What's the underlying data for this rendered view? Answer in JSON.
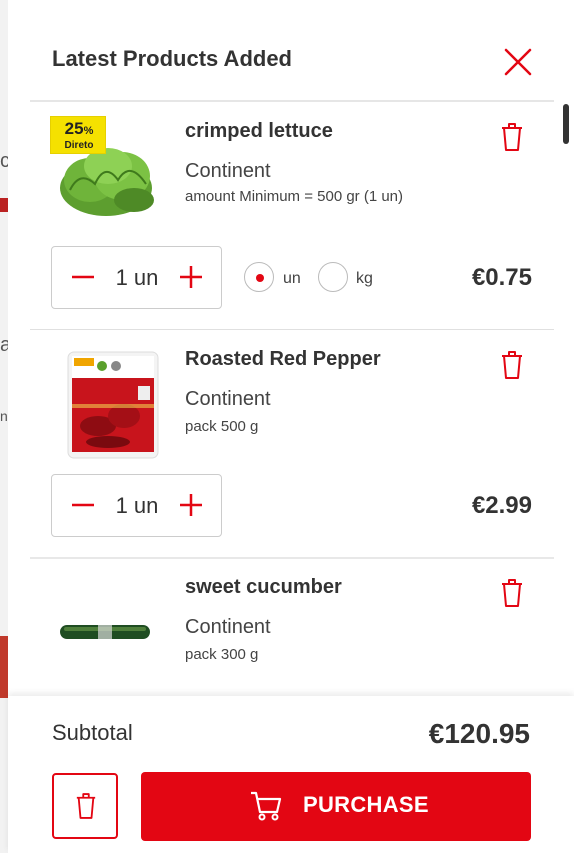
{
  "background_page": {
    "chars": [
      "c",
      "a",
      "n"
    ]
  },
  "cart": {
    "title": "Latest Products Added",
    "items": [
      {
        "name": "crimped lettuce",
        "brand": "Continent",
        "amount": "amount Minimum = 500 gr (1 un)",
        "badge": {
          "value": "25",
          "unit": "%",
          "label": "Direto"
        },
        "quantity": "1 un",
        "unit_options": [
          {
            "label": "un",
            "selected": true
          },
          {
            "label": "kg",
            "selected": false
          }
        ],
        "price": "€0.75",
        "image": "lettuce-image"
      },
      {
        "name": "Roasted Red Pepper",
        "brand": "Continent",
        "amount": "pack 500 g",
        "quantity": "1 un",
        "price": "€2.99",
        "image": "roasted-pepper-pack-image"
      },
      {
        "name": "sweet cucumber",
        "brand": "Continent",
        "amount": "pack 300 g",
        "image": "cucumber-image"
      }
    ],
    "subtotal_label": "Subtotal",
    "subtotal_value": "€120.95",
    "purchase_label": "PURCHASE"
  },
  "icons": {
    "close": "close-icon",
    "trash": "trash-icon",
    "minus": "minus-icon",
    "plus": "plus-icon",
    "cart": "shopping-cart-icon"
  },
  "colors": {
    "accent": "#e30613",
    "badge": "#f5e100",
    "text": "#333333"
  }
}
